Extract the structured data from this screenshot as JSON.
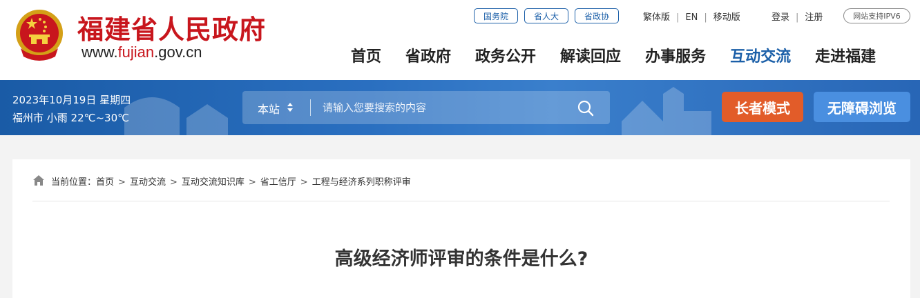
{
  "header": {
    "site_title": "福建省人民政府",
    "site_url_prefix": "www.",
    "site_url_highlight": "fujian",
    "site_url_suffix": ".gov.cn",
    "pills": [
      "国务院",
      "省人大",
      "省政协"
    ],
    "lang_links": [
      "繁体版",
      "EN",
      "移动版"
    ],
    "account_links": [
      "登录",
      "注册"
    ],
    "ipv6_badge": "网站支持IPV6",
    "nav": [
      {
        "label": "首页",
        "active": false
      },
      {
        "label": "省政府",
        "active": false
      },
      {
        "label": "政务公开",
        "active": false
      },
      {
        "label": "解读回应",
        "active": false
      },
      {
        "label": "办事服务",
        "active": false
      },
      {
        "label": "互动交流",
        "active": true
      },
      {
        "label": "走进福建",
        "active": false
      }
    ]
  },
  "band": {
    "date": "2023年10月19日 星期四",
    "weather": "福州市 小雨 22℃~30℃",
    "search_scope": "本站",
    "search_placeholder": "请输入您要搜索的内容",
    "elder_mode": "长者模式",
    "accessible_mode": "无障碍浏览"
  },
  "content": {
    "breadcrumb_label": "当前位置：",
    "breadcrumb": [
      "首页",
      "互动交流",
      "互动交流知识库",
      "省工信厅",
      "工程与经济系列职称评审"
    ],
    "article_title": "高级经济师评审的条件是什么?"
  },
  "colors": {
    "brand_red": "#c8161d",
    "brand_blue": "#1b5fa8",
    "elder_orange": "#e25c29",
    "access_blue": "#4a8fe0"
  },
  "icons": {
    "emblem": "national-emblem-icon",
    "scope": "sort-arrows-icon",
    "search": "search-icon",
    "home": "home-icon"
  }
}
